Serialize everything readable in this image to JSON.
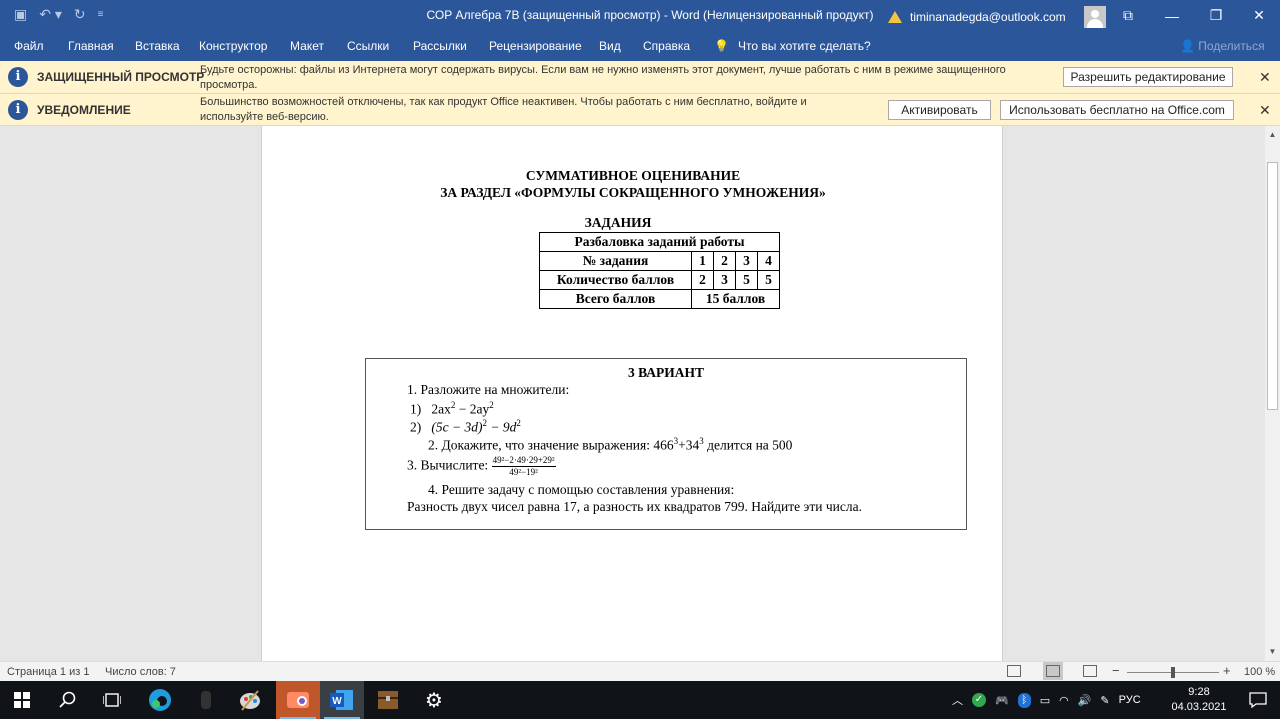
{
  "titlebar": {
    "title": "СОР Алгебра 7В (защищенный просмотр)  -  Word (Нелицензированный продукт)",
    "user_email": "timinanadegda@outlook.com"
  },
  "ribbon": {
    "tabs": [
      "Файл",
      "Главная",
      "Вставка",
      "Конструктор",
      "Макет",
      "Ссылки",
      "Рассылки",
      "Рецензирование",
      "Вид",
      "Справка"
    ],
    "tell_me": "Что вы хотите сделать?",
    "share": "Поделиться"
  },
  "protected_bar": {
    "heading": "ЗАЩИЩЕННЫЙ ПРОСМОТР",
    "message": "Будьте осторожны: файлы из Интернета могут содержать вирусы. Если вам не нужно изменять этот документ, лучше работать с ним в режиме защищенного просмотра.",
    "enable_button": "Разрешить редактирование"
  },
  "notice_bar": {
    "heading": "УВЕДОМЛЕНИЕ",
    "message": "Большинство возможностей отключены, так как продукт Office неактивен. Чтобы работать с ним бесплатно, войдите и используйте веб-версию.",
    "activate_button": "Активировать",
    "free_button": "Использовать бесплатно на Office.com"
  },
  "document": {
    "heading_line1": "СУММАТИВНОЕ ОЦЕНИВАНИЕ",
    "heading_line2": "ЗА РАЗДЕЛ «ФОРМУЛЫ СОКРАЩЕННОГО УМНОЖЕНИЯ»",
    "tasks_heading": "ЗАДАНИЯ",
    "table": {
      "caption": "Разбаловка заданий работы",
      "row_task_label": "№ задания",
      "task_numbers": [
        "1",
        "2",
        "3",
        "4"
      ],
      "row_points_label": "Количество баллов",
      "points": [
        "2",
        "3",
        "5",
        "5"
      ],
      "row_total_label": "Всего баллов",
      "total": "15 баллов"
    },
    "variant": {
      "title": "3 ВАРИАНТ",
      "task1": "1. Разложите на множители:",
      "task1_item1_num": "1)",
      "task1_item1_a": "2ax",
      "task1_item1_b": " − 2ay",
      "task1_item2_num": "2)",
      "task1_item2_a": "(5c − 3d)",
      "task1_item2_b": " − 9d",
      "sup2": "2",
      "sup3": "3",
      "task2_a": "2. Докажите, что значение выражения: 466",
      "task2_b": "+34",
      "task2_c": " делится на 500",
      "task3_label": "3. Вычислите:",
      "task3_numerator": "49²−2·49·29+29²",
      "task3_denominator": "49²−19²",
      "task4": "4. Решите задачу с помощью составления уравнения:",
      "task4_text": "Разность двух чисел равна 17, а разность их квадратов 799. Найдите эти числа."
    }
  },
  "statusbar": {
    "page": "Страница 1 из 1",
    "words": "Число слов: 7",
    "zoom": "100 %"
  },
  "taskbar": {
    "language": "РУС",
    "time": "9:28",
    "date": "04.03.2021"
  },
  "colors": {
    "word_blue": "#2b579a",
    "message_bar": "#fff4ce",
    "taskbar": "#101418"
  }
}
